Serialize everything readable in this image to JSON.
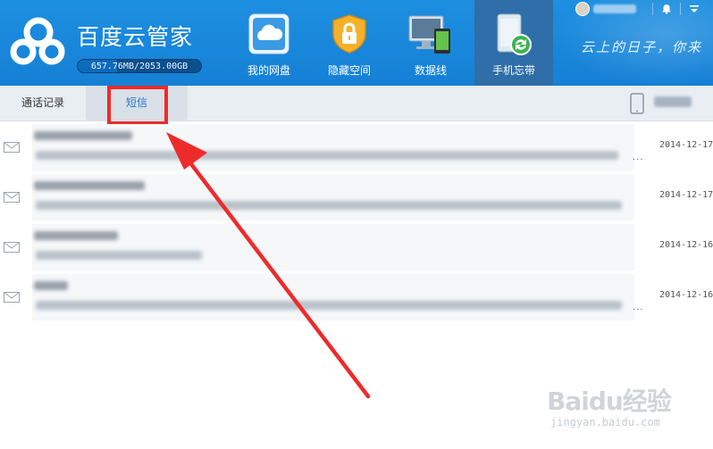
{
  "header": {
    "app_title": "百度云管家",
    "storage_text": "657.76MB/2053.00GB",
    "storage_used_fraction": 0.32,
    "nav": [
      {
        "label": "我的网盘",
        "icon": "cloud-drive-icon",
        "active": false
      },
      {
        "label": "隐藏空间",
        "icon": "lock-icon",
        "active": false
      },
      {
        "label": "数据线",
        "icon": "devices-icon",
        "active": false
      },
      {
        "label": "手机忘带",
        "icon": "phone-sync-icon",
        "active": true
      }
    ],
    "slogan": "云上的日子，你来"
  },
  "subbar": {
    "tabs": [
      {
        "label": "通话记录",
        "active": false
      },
      {
        "label": "短信",
        "active": true
      }
    ]
  },
  "messages": [
    {
      "date": "2014-12-17",
      "has_more": true
    },
    {
      "date": "2014-12-17",
      "has_more": false
    },
    {
      "date": "2014-12-16",
      "has_more": false
    },
    {
      "date": "2014-12-16",
      "has_more": true
    }
  ],
  "watermark": {
    "brand": "Baidu经验",
    "url": "jingyan.baidu.com"
  },
  "colors": {
    "header_blue": "#1580d6",
    "active_nav": "#2f6ea8",
    "highlight_red": "#ee2b2b",
    "link_blue": "#2277cc"
  }
}
